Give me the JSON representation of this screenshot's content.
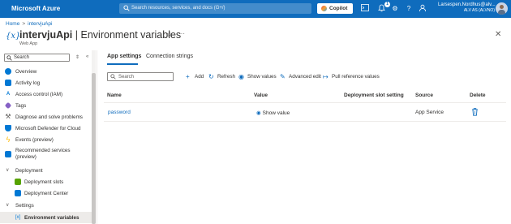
{
  "topbar": {
    "brand": "Microsoft Azure",
    "search_placeholder": "Search resources, services, and docs (G+/)",
    "copilot_label": "Copilot",
    "notification_count": "1",
    "user_name": "Larsespen.Nordhus@alv...",
    "user_tenant": "ALV AS (ALVNO)"
  },
  "breadcrumb": {
    "home": "Home",
    "separator": ">",
    "resource": "intervjuApi"
  },
  "header": {
    "resource_name": "intervjuApi",
    "title_separator": "|",
    "page_title": "Environment variables",
    "resource_type": "Web App",
    "icon_glyph": "{x}"
  },
  "sidebar": {
    "search_placeholder": "Search",
    "items": [
      {
        "label": "Overview",
        "icon": "globe-icon",
        "color": "#0078d4"
      },
      {
        "label": "Activity log",
        "icon": "activity-log-icon",
        "color": "#0078d4"
      },
      {
        "label": "Access control (IAM)",
        "icon": "iam-icon",
        "color": "#0078d4"
      },
      {
        "label": "Tags",
        "icon": "tag-icon",
        "color": "#8661c5"
      },
      {
        "label": "Diagnose and solve problems",
        "icon": "wrench-icon",
        "color": "#605e5c"
      },
      {
        "label": "Microsoft Defender for Cloud",
        "icon": "shield-icon",
        "color": "#0078d4"
      },
      {
        "label": "Events (preview)",
        "icon": "lightning-icon",
        "color": "#ffb900"
      },
      {
        "label": "Recommended services (preview)",
        "icon": "grid-icon",
        "color": "#0078d4"
      }
    ],
    "group_deployment": "Deployment",
    "deployment_items": [
      {
        "label": "Deployment slots",
        "icon": "slots-icon",
        "color": "#57a300"
      },
      {
        "label": "Deployment Center",
        "icon": "cube-icon",
        "color": "#0078d4"
      }
    ],
    "group_settings": "Settings",
    "settings_items": [
      {
        "label": "Environment variables",
        "icon": "env-var-icon",
        "glyph": "[x]",
        "color": "#0078d4"
      }
    ]
  },
  "tabs": [
    {
      "label": "App settings",
      "active": true
    },
    {
      "label": "Connection strings",
      "active": false
    }
  ],
  "toolbar": {
    "filter_placeholder": "Search",
    "add": "Add",
    "refresh": "Refresh",
    "show_values": "Show values",
    "advanced_edit": "Advanced edit",
    "pull_reference": "Pull reference values"
  },
  "table": {
    "columns": [
      "Name",
      "Value",
      "Deployment slot setting",
      "Source",
      "Delete"
    ],
    "rows": [
      {
        "name": "password",
        "value": "Show value",
        "slot_setting": "",
        "source": "App Service"
      }
    ]
  },
  "colors": {
    "accent": "#0f6cbd",
    "topbar": "#0f6cbd",
    "selected_bg": "#edebe9"
  }
}
